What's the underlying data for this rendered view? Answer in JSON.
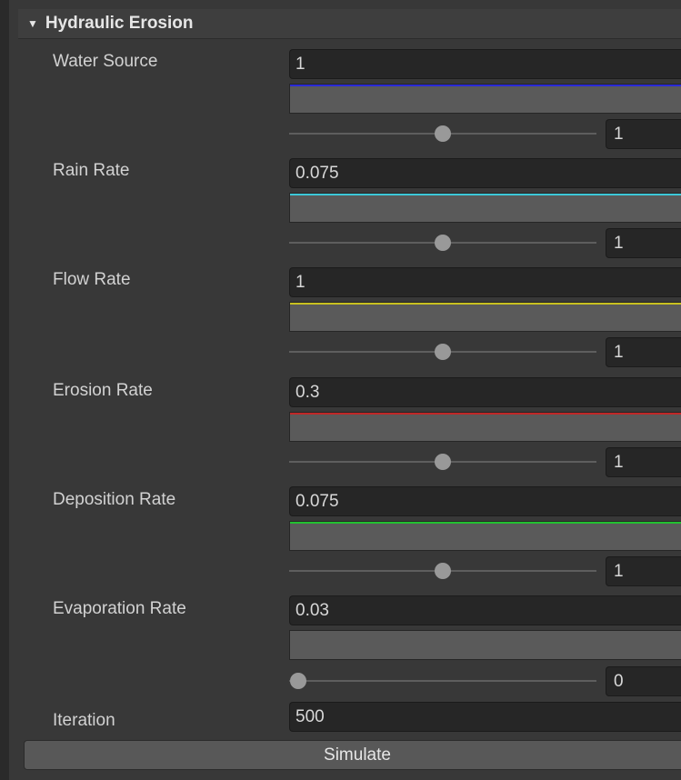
{
  "section": {
    "title": "Hydraulic Erosion",
    "collapse_icon": "triangle-down-icon"
  },
  "rows": [
    {
      "label": "Water Source",
      "value": "1",
      "color": "#2a2ad8",
      "slider_value": "1",
      "slider_fraction": 0.5
    },
    {
      "label": "Rain Rate",
      "value": "0.075",
      "color": "#3cc8d8",
      "slider_value": "1",
      "slider_fraction": 0.5
    },
    {
      "label": "Flow Rate",
      "value": "1",
      "color": "#c8c020",
      "slider_value": "1",
      "slider_fraction": 0.5
    },
    {
      "label": "Erosion Rate",
      "value": "0.3",
      "color": "#c02828",
      "slider_value": "1",
      "slider_fraction": 0.5
    },
    {
      "label": "Deposition Rate",
      "value": "0.075",
      "color": "#22c030",
      "slider_value": "1",
      "slider_fraction": 0.5
    },
    {
      "label": "Evaporation Rate",
      "value": "0.03",
      "color": "#5a5a5a",
      "slider_value": "0",
      "slider_fraction": 0.0
    }
  ],
  "iteration": {
    "label": "Iteration",
    "value": "500"
  },
  "simulate_button": {
    "label": "Simulate"
  }
}
